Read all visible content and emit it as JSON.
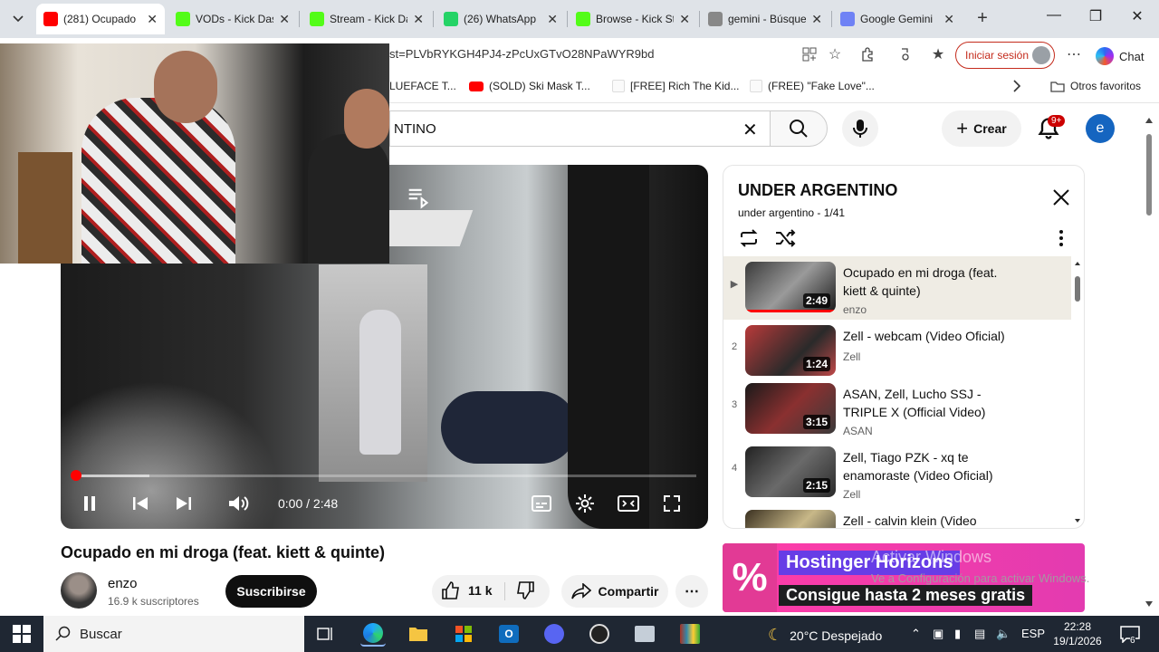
{
  "browser": {
    "tabs": [
      {
        "title": "(281) Ocupado",
        "active": true,
        "favicon": "youtube-icon",
        "color": "#ff0000"
      },
      {
        "title": "VODs - Kick Dash",
        "active": false,
        "favicon": "kick-icon",
        "color": "#53fc18"
      },
      {
        "title": "Stream - Kick Da",
        "active": false,
        "favicon": "kick-icon",
        "color": "#53fc18"
      },
      {
        "title": "(26) WhatsApp",
        "active": false,
        "favicon": "whatsapp-icon",
        "color": "#25d366"
      },
      {
        "title": "Browse - Kick Str",
        "active": false,
        "favicon": "kick-icon",
        "color": "#53fc18"
      },
      {
        "title": "gemini - Búsqueda",
        "active": false,
        "favicon": "search-icon",
        "color": "#888888"
      },
      {
        "title": "Google Gemini",
        "active": false,
        "favicon": "gemini-icon",
        "color": "#6f82f5"
      }
    ],
    "url": "st=PLVbRYKGH4PJ4-zPcUxGTvO28NPaWYR9bd",
    "signin_label": "Iniciar sesión",
    "chat_label": "Chat",
    "bookmarks": [
      {
        "label": "LUEFACE T...",
        "icon": "none"
      },
      {
        "label": "(SOLD) Ski Mask T...",
        "icon": "youtube-icon"
      },
      {
        "label": "[FREE] Rich The Kid...",
        "icon": "page-icon"
      },
      {
        "label": "(FREE) \"Fake Love\"...",
        "icon": "page-icon"
      }
    ],
    "other_favorites": "Otros favoritos"
  },
  "youtube": {
    "search_value": "NTINO",
    "create_label": "Crear",
    "notif_count": "9+",
    "user_initial": "e"
  },
  "player": {
    "time": "0:00 / 2:48",
    "progress": 0.0,
    "buffered": 0.12
  },
  "video": {
    "title": "Ocupado en mi droga (feat. kiett & quinte)",
    "channel": "enzo",
    "subscribers": "16.9 k suscriptores",
    "subscribe_label": "Suscribirse",
    "likes": "11 k",
    "share_label": "Compartir"
  },
  "playlist": {
    "title": "UNDER ARGENTINO",
    "subtitle": "under argentino - 1/41",
    "items": [
      {
        "index": "▶",
        "title": "Ocupado en mi droga (feat. kiett & quinte)",
        "channel": "enzo",
        "duration": "2:49",
        "current": true
      },
      {
        "index": "2",
        "title": "Zell - webcam (Video Oficial)",
        "channel": "Zell",
        "duration": "1:24",
        "current": false
      },
      {
        "index": "3",
        "title": "ASAN, Zell, Lucho SSJ - TRIPLE X (Official Video)",
        "channel": "ASAN",
        "duration": "3:15",
        "current": false
      },
      {
        "index": "4",
        "title": "Zell, Tiago PZK - xq te enamoraste (Video Oficial)",
        "channel": "Zell",
        "duration": "2:15",
        "current": false
      },
      {
        "index": "",
        "title": "Zell - calvin klein (Video",
        "channel": "",
        "duration": "",
        "current": false
      }
    ]
  },
  "ad": {
    "logo": "%",
    "line1": "Hostinger Horizons",
    "line2": "Consigue hasta 2 meses gratis"
  },
  "watermark": {
    "line1": "Activar Windows",
    "line2": "Ve a Configuración para activar Windows."
  },
  "taskbar": {
    "search_label": "Buscar",
    "weather": "20°C  Despejado",
    "lang": "ESP",
    "time": "22:28",
    "date": "19/1/2026",
    "notif_count": "6"
  }
}
